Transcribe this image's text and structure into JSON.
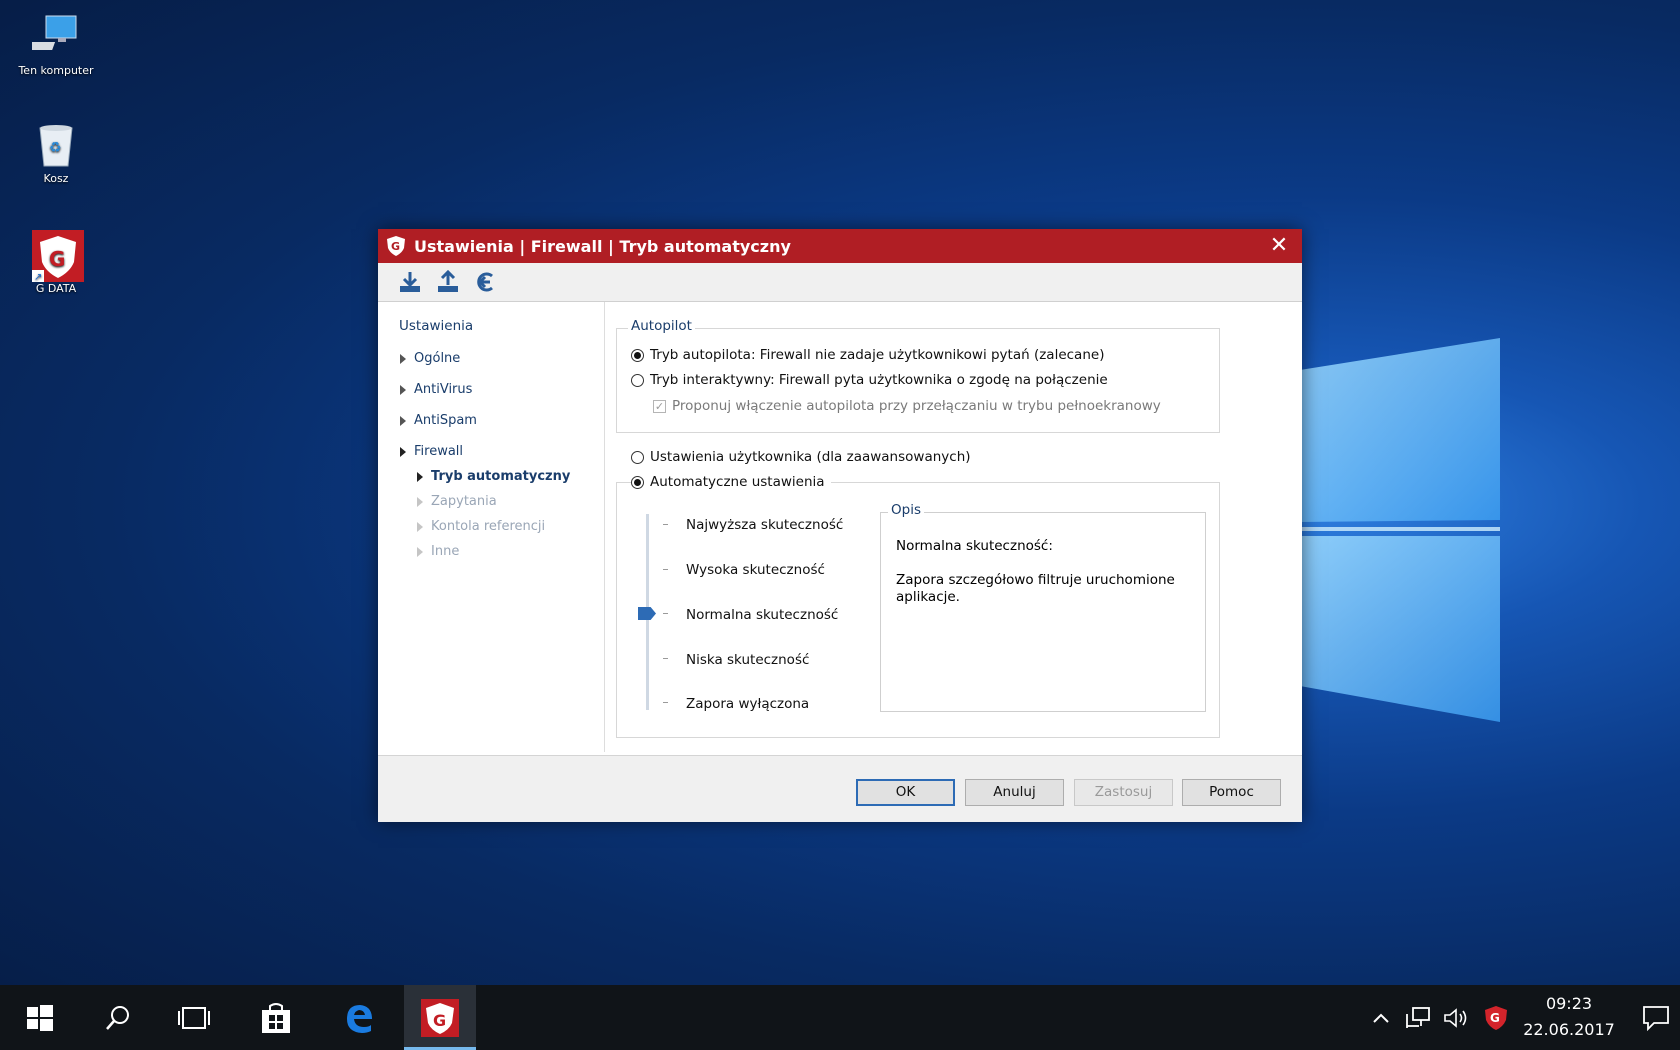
{
  "desktop": {
    "icons": [
      {
        "label": "Ten komputer",
        "icon": "computer-icon"
      },
      {
        "label": "Kosz",
        "icon": "recycle-bin-icon"
      },
      {
        "label": "G DATA",
        "icon": "gdata-shortcut-icon"
      }
    ]
  },
  "dialog": {
    "title": "Ustawienia | Firewall | Tryb automatyczny",
    "toolbar": [
      "import-icon",
      "export-icon",
      "restore-icon"
    ],
    "nav": {
      "heading": "Ustawienia",
      "items": [
        "Ogólne",
        "AntiVirus",
        "AntiSpam",
        "Firewall"
      ],
      "sub_items": [
        "Tryb automatyczny",
        "Zapytania",
        "Kontola referencji",
        "Inne"
      ]
    },
    "autopilot": {
      "legend": "Autopilot",
      "option_autopilot": "Tryb autopilota: Firewall nie zadaje użytkownikowi pytań (zalecane)",
      "option_interactive": "Tryb interaktywny: Firewall pyta użytkownika o zgodę na połączenie",
      "checkbox_fullscreen": "Proponuj włączenie autopilota przy przełączaniu w trybu pełnoekranowy",
      "autopilot_selected": true,
      "checkbox_checked": true
    },
    "user_settings": "Ustawienia użytkownika (dla zaawansowanych)",
    "auto_settings": "Automatyczne ustawienia",
    "levels": [
      "Najwyższa skuteczność",
      "Wysoka skuteczność",
      "Normalna skuteczność",
      "Niska skuteczność",
      "Zapora wyłączona"
    ],
    "selected_level_index": 2,
    "description": {
      "legend": "Opis",
      "title": "Normalna skuteczność:",
      "body": "Zapora szczegółowo filtruje uruchomione aplikacje."
    },
    "buttons": {
      "ok": "OK",
      "cancel": "Anuluj",
      "apply": "Zastosuj",
      "help": "Pomoc"
    }
  },
  "taskbar": {
    "time": "09:23",
    "date": "22.06.2017"
  },
  "colors": {
    "titlebar": "#b01e24",
    "accent": "#2d6bb5"
  }
}
